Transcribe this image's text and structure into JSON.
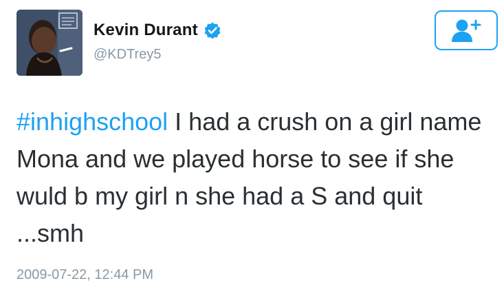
{
  "user": {
    "display_name": "Kevin Durant",
    "handle": "@KDTrey5",
    "verified": true,
    "avatar_icon": "profile-photo"
  },
  "follow_button": {
    "icon": "add-user-icon"
  },
  "tweet": {
    "hashtag": "#inhighschool",
    "body": " I had a crush on a girl name Mona and we played horse to see if she wuld b my girl n she had a S and quit ...smh",
    "timestamp": "2009-07-22, 12:44 PM"
  },
  "colors": {
    "accent": "#1da1f2",
    "text": "#292f33",
    "muted": "#8899a6"
  }
}
